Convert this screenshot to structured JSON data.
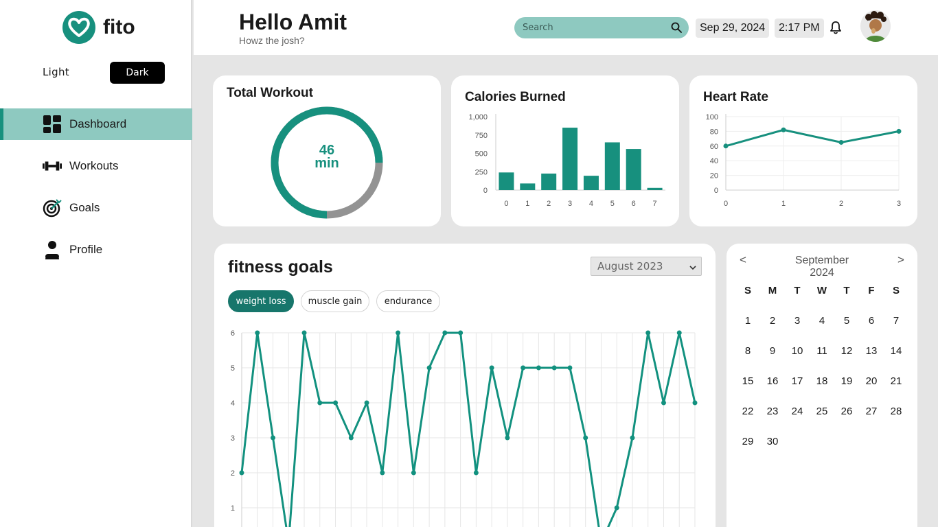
{
  "app": {
    "name": "fito"
  },
  "theme": {
    "light_label": "Light",
    "dark_label": "Dark"
  },
  "nav": [
    {
      "label": "Dashboard",
      "icon": "dashboard-icon",
      "active": true
    },
    {
      "label": "Workouts",
      "icon": "dumbbell-icon",
      "active": false
    },
    {
      "label": "Goals",
      "icon": "target-icon",
      "active": false
    },
    {
      "label": "Profile",
      "icon": "user-icon",
      "active": false
    }
  ],
  "header": {
    "greeting": "Hello Amit",
    "subtitle": "Howz the josh?",
    "search_placeholder": "Search",
    "date": "Sep 29, 2024",
    "time": "2:17 PM"
  },
  "colors": {
    "accent": "#17907e",
    "accent_light": "#8ec9c0",
    "remaining": "#939393"
  },
  "total_workout": {
    "title": "Total Workout",
    "value": "46",
    "unit": "min",
    "fraction": 0.75
  },
  "calories": {
    "title": "Calories Burned"
  },
  "heart": {
    "title": "Heart Rate"
  },
  "fitness_goals": {
    "title": "fitness goals",
    "month": "August 2023",
    "tabs": [
      {
        "label": "weight loss",
        "active": true
      },
      {
        "label": "muscle gain",
        "active": false
      },
      {
        "label": "endurance",
        "active": false
      }
    ]
  },
  "calendar": {
    "title": "September 2024",
    "prev": "<",
    "next": ">",
    "weekdays": [
      "S",
      "M",
      "T",
      "W",
      "T",
      "F",
      "S"
    ],
    "start_offset": 0,
    "days": 30
  },
  "chart_data": [
    {
      "type": "bar",
      "title": "Calories Burned",
      "categories": [
        "0",
        "1",
        "2",
        "3",
        "4",
        "5",
        "6",
        "7"
      ],
      "values": [
        240,
        90,
        225,
        850,
        195,
        650,
        560,
        30
      ],
      "ylim": [
        0,
        1000
      ],
      "yticks": [
        "0",
        "250",
        "500",
        "750",
        "1,000"
      ],
      "grid": false
    },
    {
      "type": "line",
      "title": "Heart Rate",
      "x": [
        0,
        1,
        2,
        3
      ],
      "values": [
        60,
        82,
        65,
        80
      ],
      "ylim": [
        0,
        100
      ],
      "yticks": [
        "0",
        "20",
        "40",
        "60",
        "80",
        "100"
      ],
      "grid": true
    },
    {
      "type": "line",
      "title": "fitness goals",
      "values": [
        2,
        6,
        3,
        0,
        6,
        4,
        4,
        3,
        4,
        2,
        6,
        2,
        5,
        6,
        6,
        2,
        5,
        3,
        5,
        5,
        5,
        5,
        3,
        0,
        1,
        3,
        6,
        4,
        6,
        4
      ],
      "ylim": [
        0,
        6
      ],
      "yticks": [
        "1",
        "2",
        "3",
        "4",
        "5",
        "6"
      ],
      "grid": true
    }
  ]
}
